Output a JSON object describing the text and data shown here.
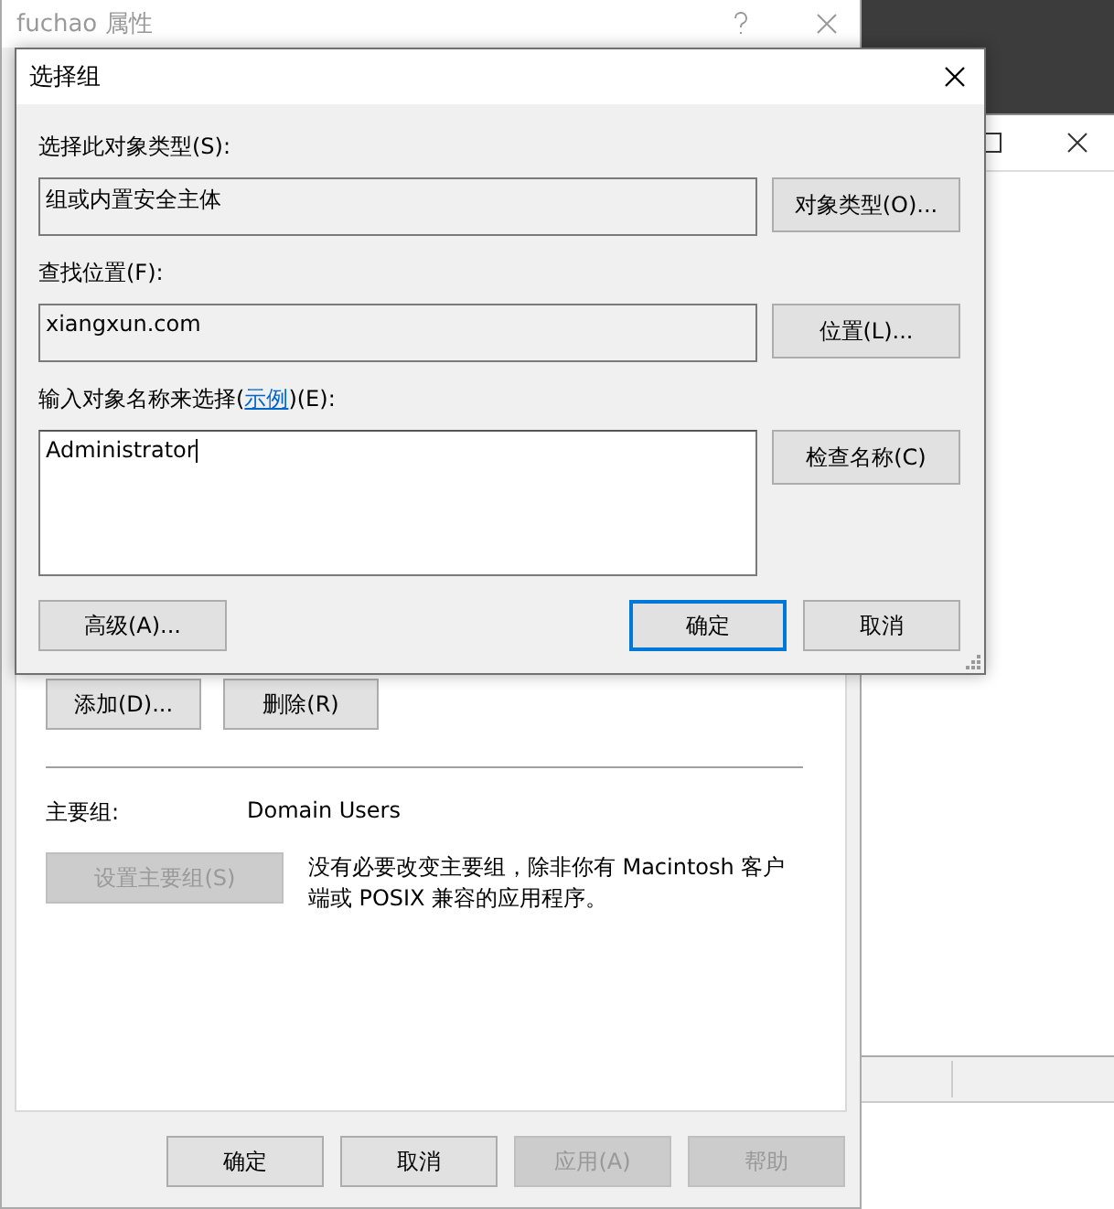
{
  "properties_window": {
    "title": "fuchao 属性",
    "active": false,
    "add_button": "添加(D)...",
    "remove_button": "删除(R)",
    "primary_group_label": "主要组:",
    "primary_group_value": "Domain Users",
    "set_primary_button": {
      "label": "设置主要组(S)",
      "disabled": true
    },
    "note": "没有必要改变主要组，除非你有 Macintosh 客户端或 POSIX 兼容的应用程序。",
    "buttons": [
      {
        "label": "确定",
        "disabled": false
      },
      {
        "label": "取消",
        "disabled": false
      },
      {
        "label": "应用(A)",
        "disabled": true
      },
      {
        "label": "帮助",
        "disabled": true
      }
    ]
  },
  "dialog": {
    "title": "选择组",
    "object_type_label": "选择此对象类型(S):",
    "object_type_value": "组或内置安全主体",
    "object_type_button": "对象类型(O)...",
    "location_label": "查找位置(F):",
    "location_value": "xiangxun.com",
    "location_button": "位置(L)...",
    "name_label_before": "输入对象名称来选择(",
    "name_label_link": "示例",
    "name_label_after": ")(E):",
    "name_value": "Administrator",
    "check_names_button": "检查名称(C)",
    "buttons": [
      {
        "label": "高级(A)...",
        "default": false
      },
      {
        "label": "确定",
        "default": true
      },
      {
        "label": "取消",
        "default": false
      }
    ]
  }
}
